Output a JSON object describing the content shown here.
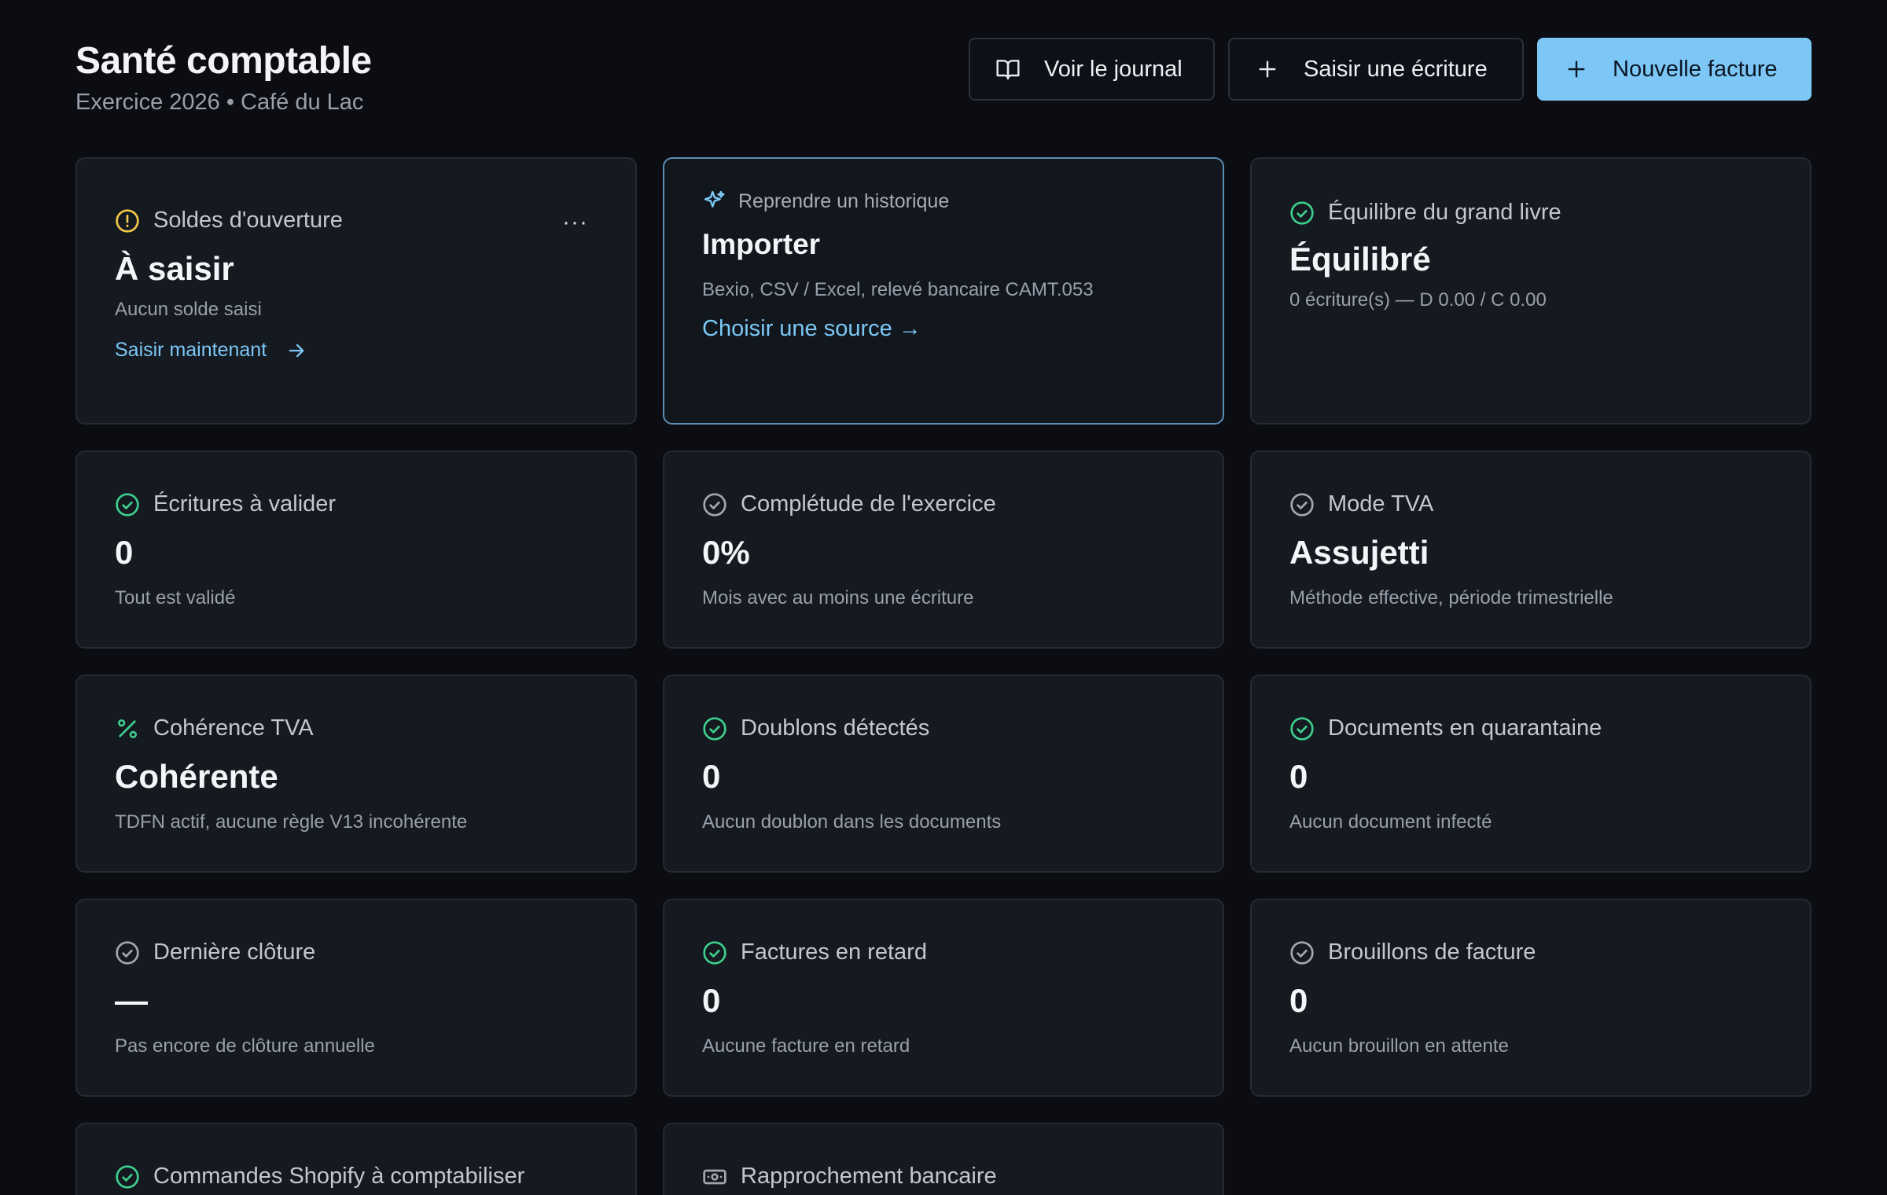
{
  "header": {
    "title": "Santé comptable",
    "subtitle": "Exercice 2026 • Café du Lac",
    "actions": {
      "journal": "Voir le journal",
      "entry": "Saisir une écriture",
      "invoice": "Nouvelle facture"
    }
  },
  "colors": {
    "background": "#0b0d12",
    "card": "#151920",
    "accent": "#7cc7f5",
    "success": "#3ecf8e",
    "warning": "#f2c94c",
    "muted_icon": "#a2a7b0"
  },
  "cards": {
    "opening": {
      "label": "Soldes d'ouverture",
      "value": "À saisir",
      "desc": "Aucun solde saisi",
      "link": "Saisir maintenant",
      "more": "···",
      "icon": "warning-circle-icon"
    },
    "import": {
      "kicker": "Reprendre un historique",
      "title": "Importer",
      "desc": "Bexio, CSV / Excel, relevé bancaire CAMT.053",
      "link": "Choisir une source →",
      "icon": "sparkles-icon"
    },
    "ledger": {
      "label": "Équilibre du grand livre",
      "value": "Équilibré",
      "desc": "0 écriture(s) — D 0.00 / C 0.00",
      "icon": "check-circle-icon"
    },
    "to_validate": {
      "label": "Écritures à valider",
      "value": "0",
      "desc": "Tout est validé",
      "icon": "check-circle-icon"
    },
    "completeness": {
      "label": "Complétude de l'exercice",
      "value": "0%",
      "desc": "Mois avec au moins une écriture",
      "icon": "check-circle-icon"
    },
    "vat_mode": {
      "label": "Mode TVA",
      "value": "Assujetti",
      "desc": "Méthode effective, période trimestrielle",
      "icon": "check-circle-icon"
    },
    "vat_coherence": {
      "label": "Cohérence TVA",
      "value": "Cohérente",
      "desc": "TDFN actif, aucune règle V13 incohérente",
      "icon": "percent-icon"
    },
    "duplicates": {
      "label": "Doublons détectés",
      "value": "0",
      "desc": "Aucun doublon dans les documents",
      "icon": "check-circle-icon"
    },
    "quarantine": {
      "label": "Documents en quarantaine",
      "value": "0",
      "desc": "Aucun document infecté",
      "icon": "check-circle-icon"
    },
    "closing": {
      "label": "Dernière clôture",
      "value": "—",
      "desc": "Pas encore de clôture annuelle",
      "icon": "check-circle-icon"
    },
    "overdue": {
      "label": "Factures en retard",
      "value": "0",
      "desc": "Aucune facture en retard",
      "icon": "check-circle-icon"
    },
    "drafts": {
      "label": "Brouillons de facture",
      "value": "0",
      "desc": "Aucun brouillon en attente",
      "icon": "check-circle-icon"
    },
    "shopify": {
      "label": "Commandes Shopify à comptabiliser",
      "icon": "check-circle-icon"
    },
    "bank": {
      "label": "Rapprochement bancaire",
      "icon": "banknote-icon"
    }
  }
}
